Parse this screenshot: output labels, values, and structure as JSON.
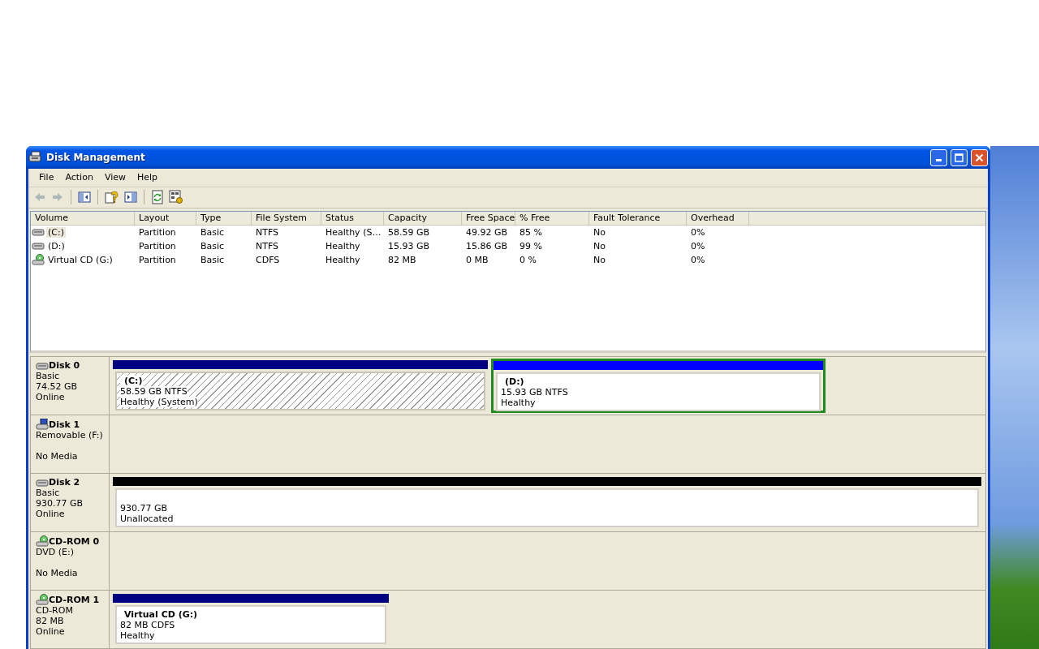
{
  "window": {
    "title": "Disk Management"
  },
  "menu": [
    "File",
    "Action",
    "View",
    "Help"
  ],
  "toolbar": [
    {
      "kind": "back",
      "disabled": true
    },
    {
      "kind": "forward",
      "disabled": true
    },
    {
      "kind": "separator",
      "disabled": false
    },
    {
      "kind": "tree",
      "disabled": false
    },
    {
      "kind": "separator",
      "disabled": false
    },
    {
      "kind": "help",
      "disabled": false
    },
    {
      "kind": "pane",
      "disabled": false
    },
    {
      "kind": "separator",
      "disabled": false
    },
    {
      "kind": "refresh",
      "disabled": false
    },
    {
      "kind": "properties",
      "disabled": false
    }
  ],
  "volume_list": {
    "columns": [
      "Volume",
      "Layout",
      "Type",
      "File System",
      "Status",
      "Capacity",
      "Free Space",
      "% Free",
      "Fault Tolerance",
      "Overhead"
    ],
    "rows": [
      {
        "kind": "disk",
        "selected": true,
        "cells": [
          "(C:)",
          "Partition",
          "Basic",
          "NTFS",
          "Healthy (S…",
          "58.59 GB",
          "49.92 GB",
          "85 %",
          "No",
          "0%"
        ]
      },
      {
        "kind": "disk",
        "selected": false,
        "cells": [
          "(D:)",
          "Partition",
          "Basic",
          "NTFS",
          "Healthy",
          "15.93 GB",
          "15.86 GB",
          "99 %",
          "No",
          "0%"
        ]
      },
      {
        "kind": "cd",
        "selected": false,
        "cells": [
          "Virtual CD (G:)",
          "Partition",
          "Basic",
          "CDFS",
          "Healthy",
          "82 MB",
          "0 MB",
          "0 %",
          "No",
          "0%"
        ]
      }
    ]
  },
  "disks": [
    {
      "kind": "disk",
      "name": "Disk 0",
      "type": "Basic",
      "size": "74.52 GB",
      "status": "Online",
      "partitions": [
        {
          "kind": "primary",
          "selected": true,
          "label": "(C:)",
          "size": "58.59 GB NTFS",
          "status": "Healthy (System)"
        },
        {
          "kind": "logical",
          "selected": false,
          "label": "(D:)",
          "size": "15.93 GB NTFS",
          "status": "Healthy"
        }
      ]
    },
    {
      "kind": "removable",
      "name": "Disk 1",
      "type": "Removable (F:)",
      "status": "No Media"
    },
    {
      "kind": "disk",
      "name": "Disk 2",
      "type": "Basic",
      "size": "930.77 GB",
      "status": "Online",
      "partitions": [
        {
          "kind": "unallocated",
          "selected": false,
          "size": "930.77 GB",
          "status": "Unallocated"
        }
      ]
    },
    {
      "kind": "cd",
      "name": "CD-ROM 0",
      "type": "DVD (E:)",
      "status": "No Media"
    },
    {
      "kind": "cd",
      "name": "CD-ROM 1",
      "type": "CD-ROM",
      "size": "82 MB",
      "status": "Online",
      "partitions": [
        {
          "kind": "primary",
          "selected": false,
          "label": "Virtual CD  (G:)",
          "size": "82 MB CDFS",
          "status": "Healthy"
        }
      ]
    }
  ]
}
